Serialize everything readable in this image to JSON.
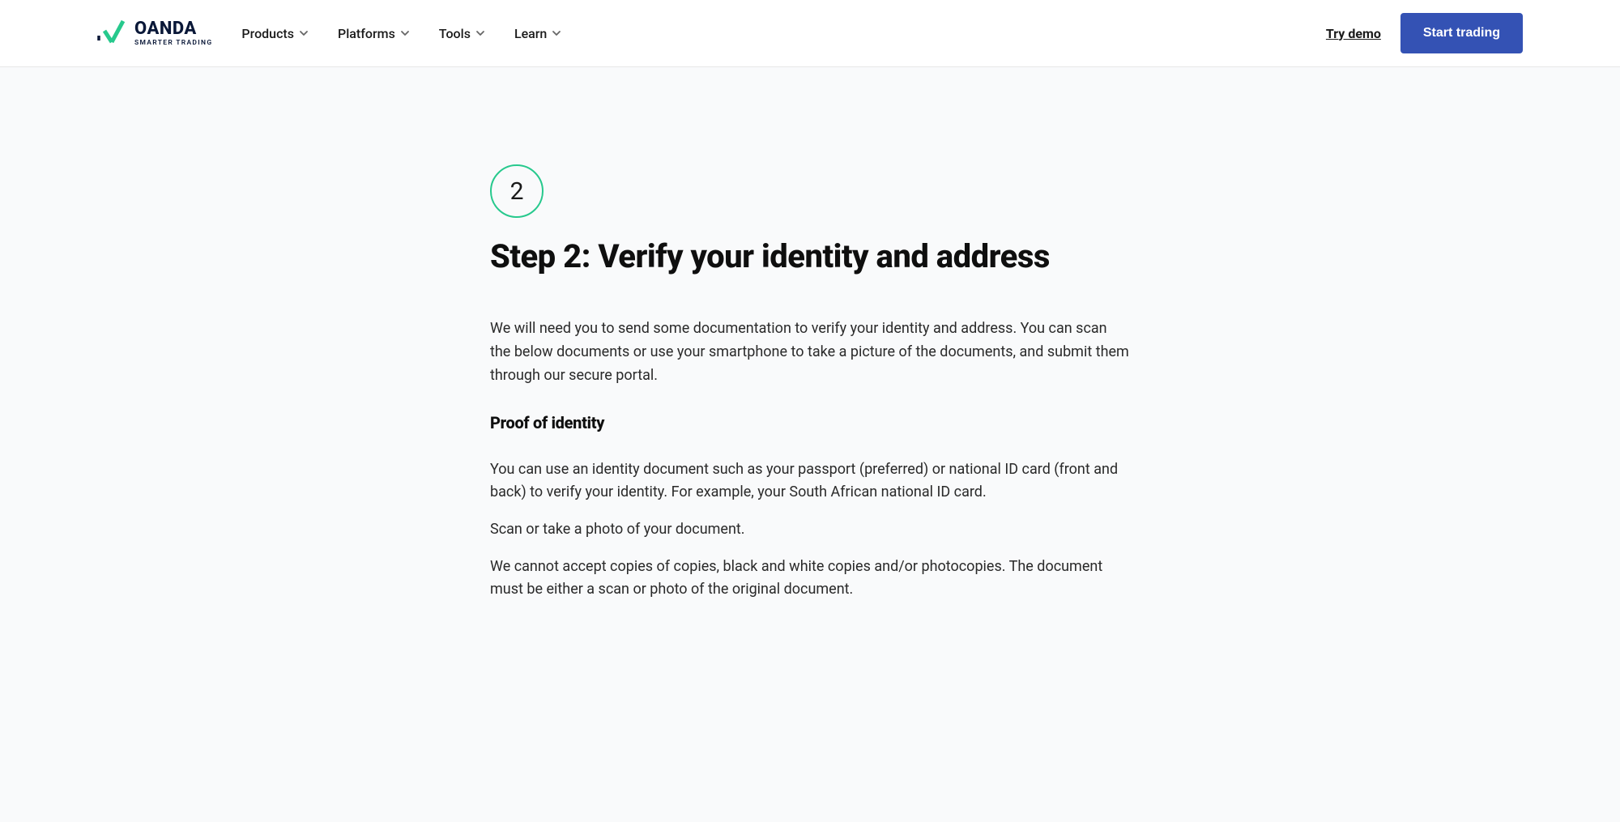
{
  "header": {
    "logo": {
      "name": "OANDA",
      "tagline": "SMARTER TRADING"
    },
    "nav": [
      {
        "label": "Products"
      },
      {
        "label": "Platforms"
      },
      {
        "label": "Tools"
      },
      {
        "label": "Learn"
      }
    ],
    "try_demo": "Try demo",
    "start_trading": "Start trading"
  },
  "content": {
    "step_number": "2",
    "heading": "Step 2: Verify your identity and address",
    "intro": "We will need you to send some documentation to verify your identity and address. You can scan the below documents or use your smartphone to take a picture of the documents, and submit them through our secure portal.",
    "sub_heading": "Proof of identity",
    "paragraphs": [
      "You can use an identity document such as your passport (preferred) or national ID card (front and back) to verify your identity. For example, your South African national ID card.",
      "Scan or take a photo of your document.",
      "We cannot accept copies of copies, black and white copies and/or photocopies. The document must be either a scan or photo of the original document."
    ]
  }
}
